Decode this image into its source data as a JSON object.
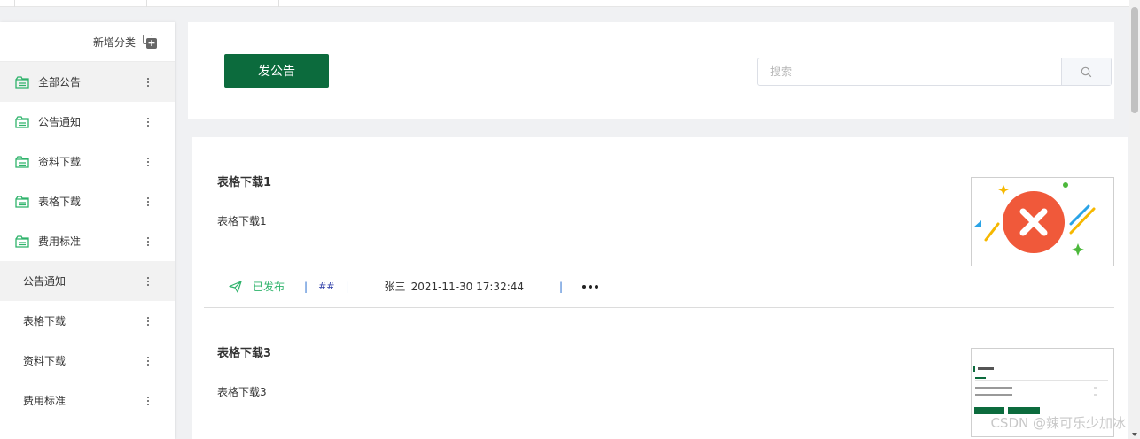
{
  "sidebar": {
    "add_category_label": "新增分类",
    "categories": [
      {
        "label": "全部公告",
        "icon": "folder-icon"
      },
      {
        "label": "公告通知",
        "icon": "folder-icon"
      },
      {
        "label": "资料下载",
        "icon": "folder-icon"
      },
      {
        "label": "表格下载",
        "icon": "folder-icon"
      },
      {
        "label": "费用标准",
        "icon": "folder-icon"
      }
    ],
    "subcategories": [
      {
        "label": "公告通知"
      },
      {
        "label": "表格下载"
      },
      {
        "label": "资料下载"
      },
      {
        "label": "费用标准"
      }
    ],
    "active_index": 0,
    "accent_color": "#2fb36b"
  },
  "toolbar": {
    "publish_label": "发公告",
    "search_placeholder": "搜索",
    "search_icon": "search-icon",
    "brand_color": "#0c6b3d"
  },
  "notices": [
    {
      "title": "表格下载1",
      "summary": "表格下载1",
      "status": "已发布",
      "tag": "##",
      "author": "张三",
      "datetime": "2021-11-30 17:32:44",
      "thumbnail": "image-load-error-icon"
    },
    {
      "title": "表格下载3",
      "summary": "表格下载3",
      "thumbnail": "document-preview-thumbnail"
    }
  ],
  "watermark": "CSDN @辣可乐少加冰"
}
